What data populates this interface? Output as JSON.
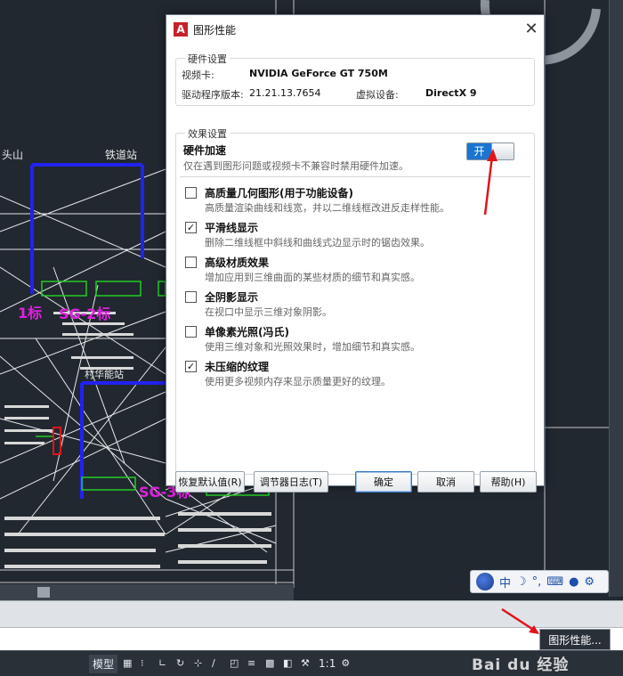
{
  "dialog": {
    "title": "图形性能",
    "close_glyph": "✕",
    "hardware": {
      "group_label": "硬件设置",
      "gpu_label": "视频卡:",
      "gpu_value": "NVIDIA GeForce GT 750M",
      "driver_label": "驱动程序版本:",
      "driver_value": "21.21.13.7654",
      "virtual_device_label": "虚拟设备:",
      "virtual_device_value": "DirectX 9"
    },
    "effects": {
      "group_label": "效果设置",
      "hw_accel_title": "硬件加速",
      "hw_accel_desc": "仅在遇到图形问题或视频卡不兼容时禁用硬件加速。",
      "toggle_label": "开",
      "toggle_on": true,
      "options": [
        {
          "title": "高质量几何图形(用于功能设备)",
          "desc": "高质量渲染曲线和线宽，并以二维线框改进反走样性能。",
          "checked": false
        },
        {
          "title": "平滑线显示",
          "desc": "删除二维线框中斜线和曲线式边显示时的锯齿效果。",
          "checked": true
        },
        {
          "title": "高级材质效果",
          "desc": "增加应用到三维曲面的某些材质的细节和真实感。",
          "checked": false
        },
        {
          "title": "全阴影显示",
          "desc": "在视口中显示三维对象阴影。",
          "checked": false
        },
        {
          "title": "单像素光照(冯氏)",
          "desc": "使用三维对象和光照效果时，增加细节和真实感。",
          "checked": false
        },
        {
          "title": "未压缩的纹理",
          "desc": "使用更多视频内存来显示质量更好的纹理。",
          "checked": true
        }
      ]
    },
    "buttons": {
      "restore": "恢复默认值(R)",
      "tuning_log": "调节器日志(T)",
      "ok": "确定",
      "cancel": "取消",
      "help": "帮助(H)"
    }
  },
  "drawing": {
    "labels": {
      "station1": "铁道站",
      "station2": "村华能站",
      "sg2": "SG-2标",
      "sg3": "SG-3标",
      "sg1": "1标",
      "mountain": "头山"
    }
  },
  "ime": {
    "label": "中"
  },
  "status_bar": {
    "model_tab": "模型",
    "zoom": "1:1",
    "perf_button": "图形性能..."
  },
  "watermark": "Bai du 经验",
  "colors": {
    "accent_blue": "#1a75d2",
    "annotation_red": "#e0141c",
    "cad_background": "#212830"
  }
}
